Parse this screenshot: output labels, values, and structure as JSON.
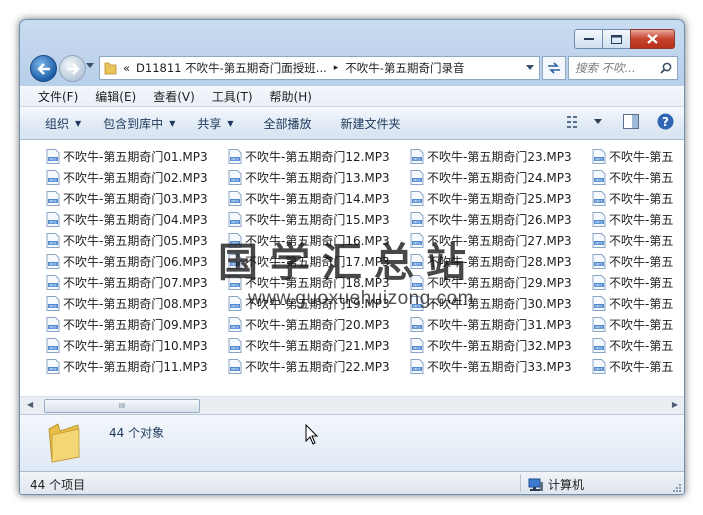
{
  "window": {
    "address": {
      "root_chevron": "«",
      "crumb1": "D11811 不吹牛-第五期奇门面授班...",
      "separator": "▸",
      "crumb2": "不吹牛-第五期奇门录音"
    },
    "search_placeholder": "搜索 不吹...",
    "menu": [
      "文件(F)",
      "编辑(E)",
      "查看(V)",
      "工具(T)",
      "帮助(H)"
    ],
    "toolbar": {
      "organize": "组织",
      "include_library": "包含到库中",
      "share": "共享",
      "play_all": "全部播放",
      "new_folder": "新建文件夹"
    },
    "files": [
      "不吹牛-第五期奇门01.MP3",
      "不吹牛-第五期奇门02.MP3",
      "不吹牛-第五期奇门03.MP3",
      "不吹牛-第五期奇门04.MP3",
      "不吹牛-第五期奇门05.MP3",
      "不吹牛-第五期奇门06.MP3",
      "不吹牛-第五期奇门07.MP3",
      "不吹牛-第五期奇门08.MP3",
      "不吹牛-第五期奇门09.MP3",
      "不吹牛-第五期奇门10.MP3",
      "不吹牛-第五期奇门11.MP3",
      "不吹牛-第五期奇门12.MP3",
      "不吹牛-第五期奇门13.MP3",
      "不吹牛-第五期奇门14.MP3",
      "不吹牛-第五期奇门15.MP3",
      "不吹牛-第五期奇门16.MP3",
      "不吹牛-第五期奇门17.MP3",
      "不吹牛-第五期奇门18.MP3",
      "不吹牛-第五期奇门19.MP3",
      "不吹牛-第五期奇门20.MP3",
      "不吹牛-第五期奇门21.MP3",
      "不吹牛-第五期奇门22.MP3",
      "不吹牛-第五期奇门23.MP3",
      "不吹牛-第五期奇门24.MP3",
      "不吹牛-第五期奇门25.MP3",
      "不吹牛-第五期奇门26.MP3",
      "不吹牛-第五期奇门27.MP3",
      "不吹牛-第五期奇门28.MP3",
      "不吹牛-第五期奇门29.MP3",
      "不吹牛-第五期奇门30.MP3",
      "不吹牛-第五期奇门31.MP3",
      "不吹牛-第五期奇门32.MP3",
      "不吹牛-第五期奇门33.MP3",
      "不吹牛-第五",
      "不吹牛-第五",
      "不吹牛-第五",
      "不吹牛-第五",
      "不吹牛-第五",
      "不吹牛-第五",
      "不吹牛-第五",
      "不吹牛-第五",
      "不吹牛-第五",
      "不吹牛-第五",
      "不吹牛-第五"
    ],
    "scrollbar_grip": "III",
    "details": {
      "object_count": "44 个对象"
    },
    "status": {
      "items": "44 个项目",
      "location": "计算机"
    }
  },
  "watermark": {
    "title": "国学汇总站",
    "url": "www.guoxuehuizong.com"
  },
  "icons": {
    "file": "mp3-file-icon",
    "folder": "folder-icon",
    "computer": "computer-icon"
  },
  "colors": {
    "frame": "#bcd3ec",
    "toolbar_text": "#1e395b",
    "close_button": "#c5432c"
  }
}
